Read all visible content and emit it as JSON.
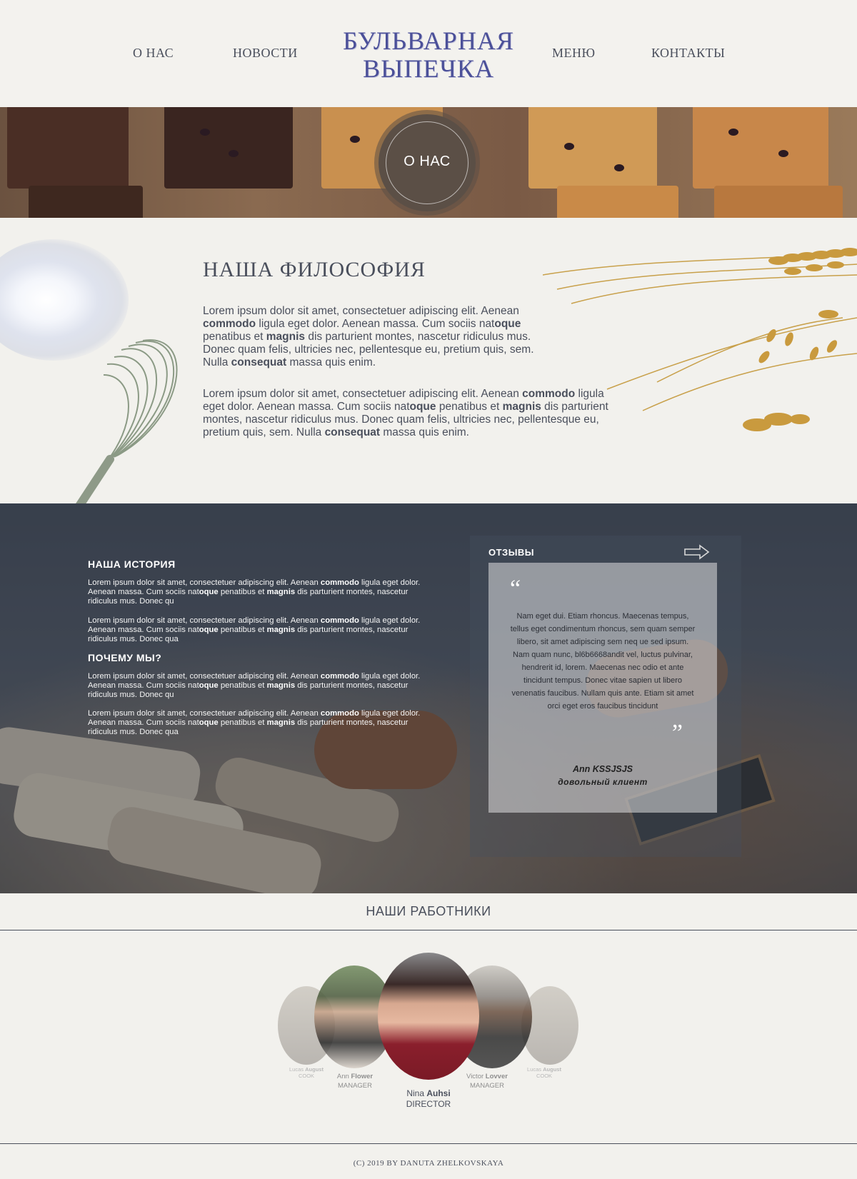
{
  "header": {
    "nav_left": [
      "О НАС",
      "НОВОСТИ"
    ],
    "logo_line1": "БУЛЬВАРНАЯ",
    "logo_line2": "ВЫПЕЧКА",
    "nav_right": [
      "МЕНЮ",
      "КОНТАКТЫ"
    ]
  },
  "hero": {
    "badge_label": "О НАС"
  },
  "philosophy": {
    "title": "НАША ФИЛОСОФИЯ",
    "paragraph1_html": "Lorem ipsum dolor sit amet, consectetuer adipiscing elit. Aenean <b>commodo</b> ligula eget dolor. Aenean massa. Cum sociis nat<b>oque</b> penatibus et <b>magnis</b> dis parturient montes, nascetur ridiculus mus. Donec quam felis, ultricies nec, pellentesque eu, pretium quis, sem. Nulla <b>consequat</b> massa quis enim.",
    "paragraph2_html": "Lorem ipsum dolor sit amet, consectetuer adipiscing elit. Aenean <b>commodo</b> ligula eget dolor. Aenean massa. Cum sociis nat<b>oque</b> penatibus et <b>magnis</b> dis parturient montes, nascetur ridiculus mus. Donec quam felis, ultricies nec, pellentesque eu, pretium quis, sem. Nulla <b>consequat</b> massa quis enim."
  },
  "history": {
    "history_title": "НАША ИСТОРИЯ",
    "why_title": "ПОЧЕМУ МЫ?",
    "p1_html": "Lorem ipsum dolor sit amet, consectetuer adipiscing elit. Aenean <b>commodo</b> ligula eget dolor. Aenean massa. Cum sociis nat<b>oque</b> penatibus et <b>magnis</b> dis parturient montes, nascetur ridiculus mus. Donec qu",
    "p2_html": "Lorem ipsum dolor sit amet, consectetuer adipiscing elit. Aenean <b>commodo</b> ligula eget dolor. Aenean massa. Cum sociis nat<b>oque</b> penatibus et <b>magnis</b> dis parturient montes, nascetur ridiculus mus. Donec qua",
    "p3_html": "Lorem ipsum dolor sit amet, consectetuer adipiscing elit. Aenean <b>commodo</b> ligula eget dolor. Aenean massa. Cum sociis nat<b>oque</b> penatibus et <b>magnis</b> dis parturient montes, nascetur ridiculus mus. Donec qu",
    "p4_html": "Lorem ipsum dolor sit amet, consectetuer adipiscing elit. Aenean <b>commodo</b> ligula eget dolor. Aenean massa. Cum sociis nat<b>oque</b> penatibus et <b>magnis</b> dis parturient montes, nascetur ridiculus mus. Donec qua"
  },
  "reviews": {
    "title": "ОТЗЫВЫ",
    "quote_open": "“",
    "quote_close": "”",
    "text": "Nam eget dui. Etiam rhoncus. Maecenas tempus, tellus eget condimentum rhoncus, sem quam semper libero, sit amet adipiscing sem neq ue sed ipsum. Nam quam nunc, bl6b6668andit vel, luctus pulvinar, hendrerit id, lorem. Maecenas nec odio et ante tincidunt tempus. Donec vitae sapien ut libero venenatis faucibus. Nullam quis ante. Etiam sit amet orci eget eros faucibus tincidunt",
    "author": "Ann KSSJSJS",
    "author_role": "довольный клиент"
  },
  "team": {
    "title": "НАШИ РАБОТНИКИ",
    "members": [
      {
        "first": "Lucas",
        "last": "August",
        "role": "COOK"
      },
      {
        "first": "Ann",
        "last": "Flower",
        "role": "MANAGER"
      },
      {
        "first": "Nina",
        "last": "Auhsi",
        "role": "DIRECTOR"
      },
      {
        "first": "Victor",
        "last": "Lovver",
        "role": "MANAGER"
      },
      {
        "first": "Lucas",
        "last": "August",
        "role": "COOK"
      }
    ]
  },
  "footer": {
    "text": "(C) 2019  BY DANUTA ZHELKOVSKAYA"
  },
  "colors": {
    "background": "#f2f1ed",
    "logo": "#4b5099",
    "text": "#4a4f5c"
  }
}
